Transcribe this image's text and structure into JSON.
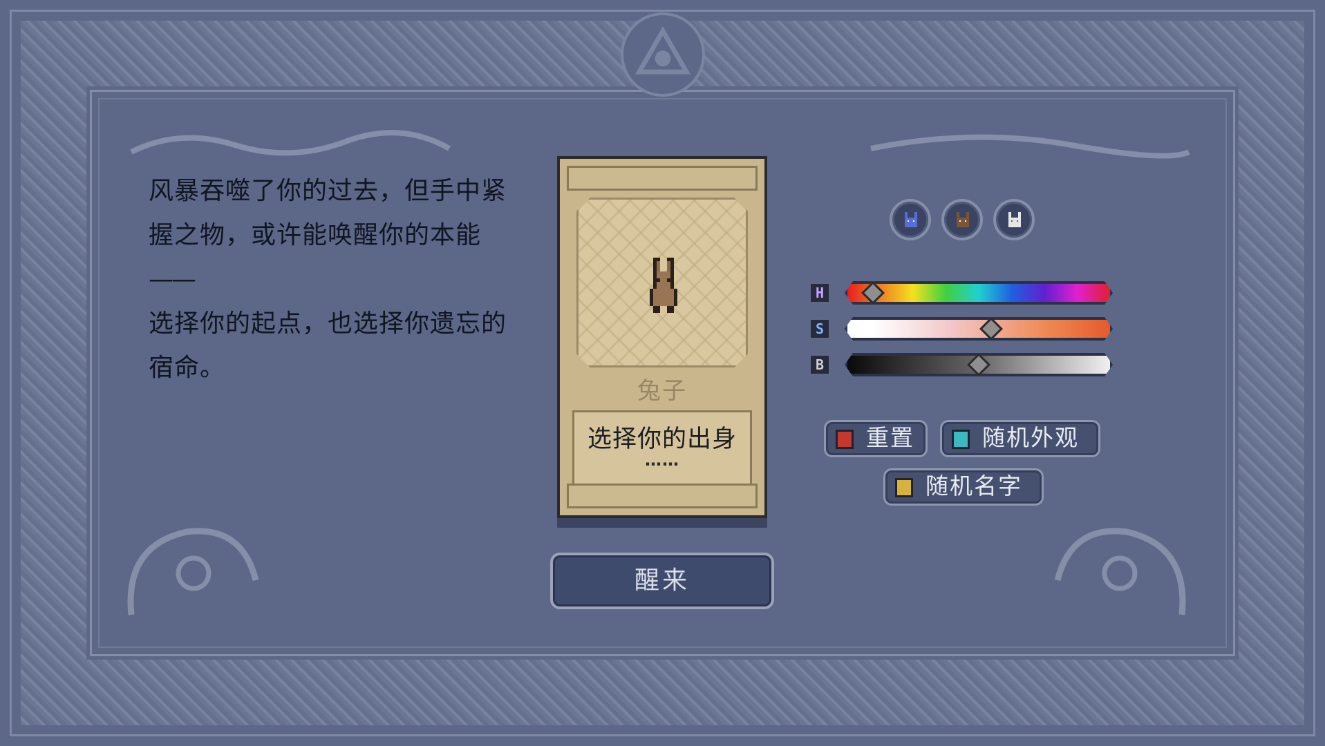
{
  "intro": {
    "line1": "风暴吞噬了你的过去，但手中紧",
    "line2": "握之物，或许能唤醒你的本能",
    "line3": "——",
    "line4": "选择你的起点，也选择你遗忘的",
    "line5": "宿命。"
  },
  "card": {
    "creature_name": "兔子",
    "title": "选择你的出身",
    "subtitle": "……"
  },
  "wake_button": {
    "label": "醒来"
  },
  "presets": [
    {
      "name": "preset-blue",
      "color": "#3a4f9a"
    },
    {
      "name": "preset-brown",
      "color": "#6e4a2f"
    },
    {
      "name": "preset-white",
      "color": "#d9d9d9"
    }
  ],
  "sliders": {
    "h": {
      "label": "H",
      "value": 0.08,
      "color": "#c9a3ff"
    },
    "s": {
      "label": "S",
      "value": 0.55,
      "color": "#7fb4ff"
    },
    "b": {
      "label": "B",
      "value": 0.5,
      "color": "#d0d0d0"
    }
  },
  "actions": {
    "reset": {
      "label": "重置",
      "icon_color": "#c6372d"
    },
    "random_look": {
      "label": "随机外观",
      "icon_color": "#3bb8c2"
    },
    "random_name": {
      "label": "随机名字",
      "icon_color": "#d8b23a"
    }
  }
}
